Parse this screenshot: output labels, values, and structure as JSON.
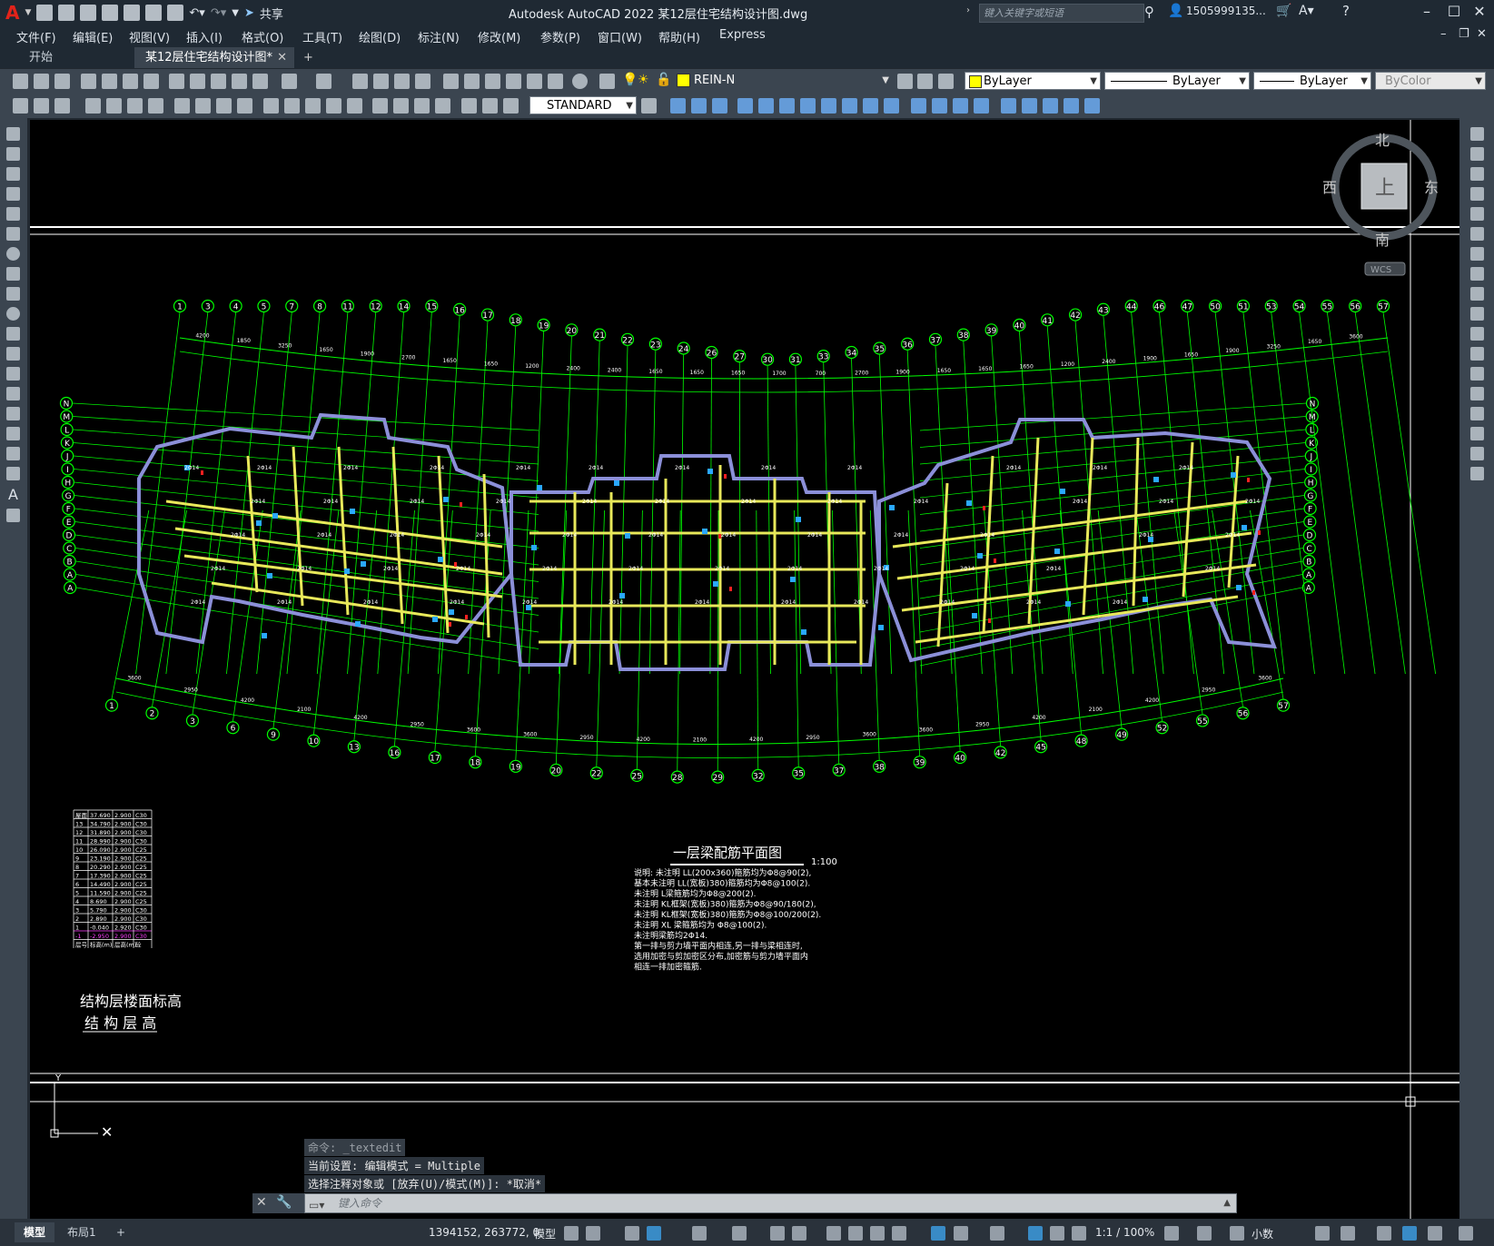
{
  "app": {
    "title": "Autodesk AutoCAD 2022    某12层住宅结构设计图.dwg",
    "logo_letter": "A",
    "share_label": "共享",
    "search_placeholder": "键入关键字或短语",
    "user_name": "1505999135...",
    "help_icon": "question-icon"
  },
  "menu": [
    "文件(F)",
    "编辑(E)",
    "视图(V)",
    "插入(I)",
    "格式(O)",
    "工具(T)",
    "绘图(D)",
    "标注(N)",
    "修改(M)",
    "参数(P)",
    "窗口(W)",
    "帮助(H)",
    "Express"
  ],
  "tabs": {
    "start": "开始",
    "document": "某12层住宅结构设计图*",
    "add": "+"
  },
  "toolbar": {
    "layer": "REIN-N",
    "color": "ByLayer",
    "linetype": "ByLayer",
    "lineweight": "ByLayer",
    "plotstyle": "ByColor",
    "dimstyle": "STANDARD"
  },
  "viewcube": {
    "north": "北",
    "south": "南",
    "east": "东",
    "west": "西",
    "top": "上",
    "wcs": "WCS"
  },
  "drawing": {
    "plan_title": "一层梁配筋平面图",
    "scale": "1:100",
    "notes": [
      "说明: 未注明 LL(200x360)箍筋均为Φ8@90(2),",
      "    基本未注明 LL(宽板)380)箍筋均为Φ8@100(2).",
      "    未注明 L梁箍筋均为Φ8@200(2).",
      "    未注明 KL框架(宽板)380)箍筋为Φ8@90/180(2),",
      "    未注明 KL框架(宽板)380)箍筋为Φ8@100/200(2).",
      "    未注明 XL 梁箍筋均为 Φ8@100(2).",
      "    未注明梁筋均2Φ14.",
      "    第一排与剪力墙平面内相连,另一排与梁相连时,",
      "    选用加密与剪加密区分布,加密筋与剪力墙平面内",
      "    相连一排加密箍筋."
    ],
    "table_title_1": "结构层楼面标高",
    "table_title_2": "结 构 层 高",
    "floor_table": [
      [
        "屋面",
        "37.690",
        "2.900",
        "C30"
      ],
      [
        "13",
        "34.790",
        "2.900",
        "C30"
      ],
      [
        "12",
        "31.890",
        "2.900",
        "C30"
      ],
      [
        "11",
        "28.990",
        "2.900",
        "C30"
      ],
      [
        "10",
        "26.090",
        "2.900",
        "C25"
      ],
      [
        "9",
        "23.190",
        "2.900",
        "C25"
      ],
      [
        "8",
        "20.290",
        "2.900",
        "C25"
      ],
      [
        "7",
        "17.390",
        "2.900",
        "C25"
      ],
      [
        "6",
        "14.490",
        "2.900",
        "C25"
      ],
      [
        "5",
        "11.590",
        "2.900",
        "C25"
      ],
      [
        "4",
        "8.690",
        "2.900",
        "C25"
      ],
      [
        "3",
        "5.790",
        "2.900",
        "C30"
      ],
      [
        "2",
        "2.890",
        "2.900",
        "C30"
      ],
      [
        "1",
        "-0.040",
        "2.920",
        "C30"
      ],
      [
        "-1",
        "-2.950",
        "2.900",
        "C30"
      ],
      [
        "层号",
        "标高(m)",
        "层高(m)",
        "砼"
      ]
    ],
    "axis_top": [
      "1",
      "3",
      "4",
      "5",
      "7",
      "8",
      "11",
      "12",
      "14",
      "15",
      "16",
      "17",
      "18",
      "19",
      "20",
      "21",
      "22",
      "23",
      "24",
      "26",
      "27",
      "30",
      "31",
      "33",
      "34",
      "35",
      "36",
      "37",
      "38",
      "39",
      "40",
      "41",
      "42",
      "43",
      "44",
      "46",
      "47",
      "50",
      "51",
      "53",
      "54",
      "55",
      "56",
      "57"
    ],
    "axis_bottom": [
      "1",
      "2",
      "3",
      "6",
      "9",
      "10",
      "13",
      "16",
      "17",
      "18",
      "19",
      "20",
      "22",
      "25",
      "28",
      "29",
      "32",
      "35",
      "37",
      "38",
      "39",
      "40",
      "42",
      "45",
      "48",
      "49",
      "52",
      "55",
      "56",
      "57"
    ],
    "axis_left": [
      "N",
      "M",
      "L",
      "K",
      "J",
      "I",
      "H",
      "G",
      "F",
      "E",
      "D",
      "C",
      "B",
      "A",
      "A"
    ],
    "axis_right": [
      "N",
      "M",
      "L",
      "K",
      "J",
      "I",
      "H",
      "G",
      "F",
      "E",
      "D",
      "C",
      "B",
      "A",
      "A"
    ],
    "dims_top": [
      "4200",
      "1850",
      "3250",
      "1650",
      "1900",
      "2700",
      "1650",
      "1650",
      "1200",
      "2400",
      "2400",
      "1650",
      "1650",
      "1650",
      "1700",
      "700",
      "2700",
      "1900",
      "1650",
      "1650",
      "1650",
      "1200",
      "2400",
      "1900",
      "1650",
      "1900",
      "3250",
      "1650",
      "3600"
    ],
    "dims_bottom": [
      "3600",
      "2950",
      "4200",
      "2100",
      "4200",
      "2950",
      "3600",
      "3600",
      "2950",
      "4200",
      "2100",
      "4200",
      "2950",
      "3600",
      "3600",
      "2950",
      "4200",
      "2100",
      "4200",
      "2950",
      "3600"
    ],
    "beam_label": "2Φ14"
  },
  "command": {
    "history": [
      "命令: _textedit",
      "当前设置: 编辑模式 = Multiple",
      "选择注释对象或 [放弃(U)/模式(M)]: *取消*"
    ],
    "input_placeholder": "键入命令"
  },
  "status": {
    "model_tab": "模型",
    "layout_tab": "布局1",
    "add_tab": "+",
    "coords": "1394152, 263772, 0",
    "mode": "模型",
    "scale": "1:1 / 100%",
    "units": "小数"
  },
  "colors": {
    "canvas": "#000000",
    "axis": "#00ff00",
    "beam_yellow": "#e8e85a",
    "wall_blue": "#8b8fd8",
    "column": "#2aa8ff",
    "mark_red": "#ff2020",
    "text_white": "#ffffff",
    "ui_dark": "#1f2933",
    "toolbar": "#3b4550"
  }
}
